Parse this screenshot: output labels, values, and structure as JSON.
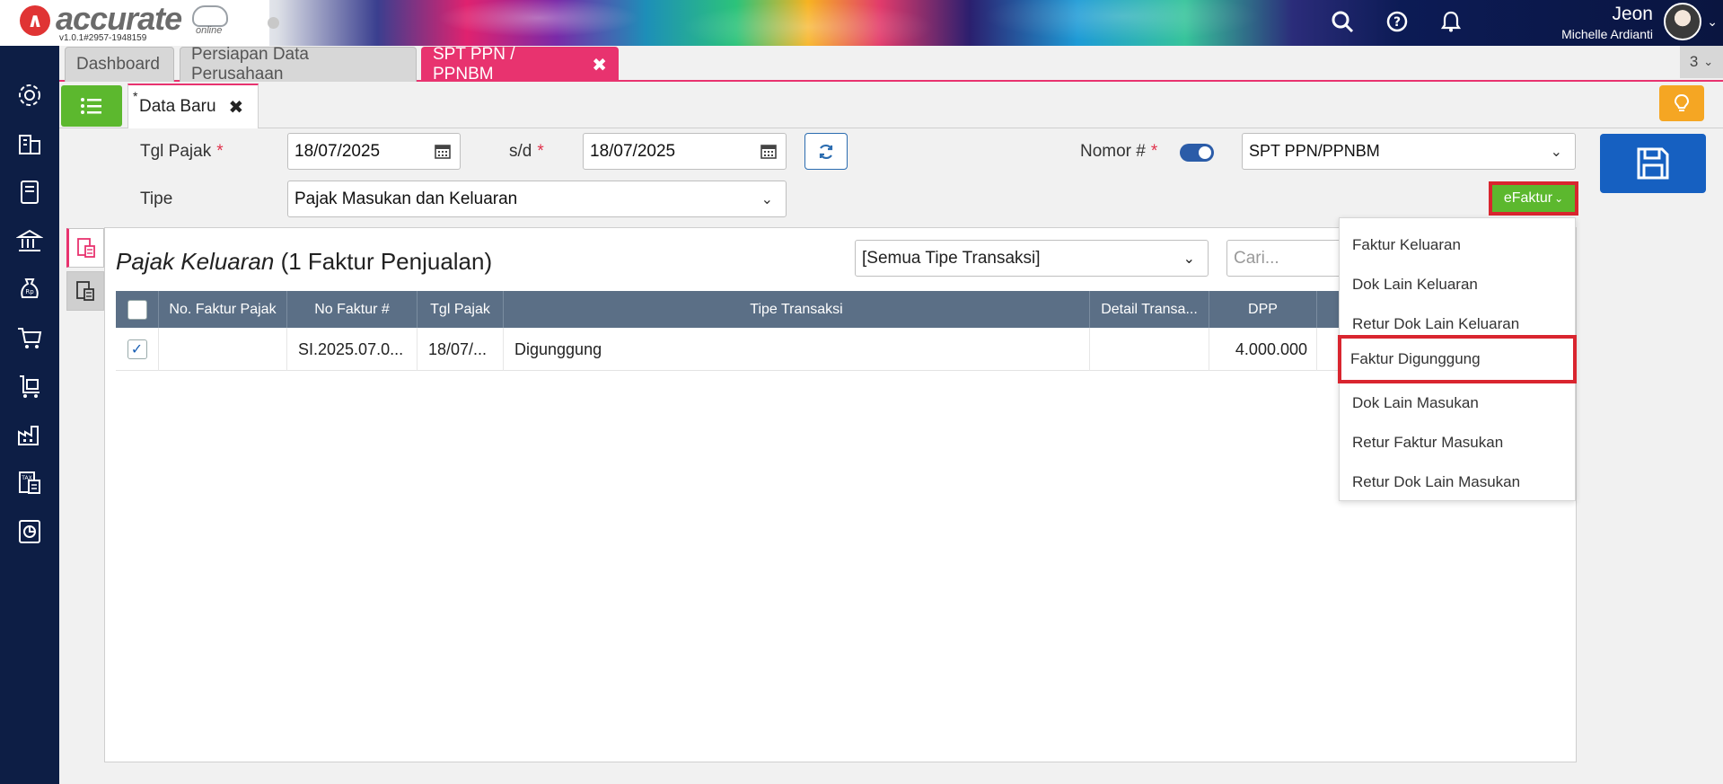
{
  "app": {
    "logo_text": "accurate",
    "logo_sub": "online",
    "version": "v1.0.1#2957-1948159"
  },
  "user": {
    "name": "Jeon",
    "company": "Michelle Ardianti"
  },
  "top_icons": [
    "search-icon",
    "help-icon",
    "bell-icon"
  ],
  "sidebar_icons": [
    "gear-icon",
    "building-icon",
    "book-icon",
    "bank-icon",
    "money-bag-icon",
    "cart-icon",
    "trolley-icon",
    "factory-icon",
    "tax-doc-icon",
    "report-icon"
  ],
  "module_tabs": [
    {
      "label": "Dashboard",
      "active": false
    },
    {
      "label": "Persiapan Data Perusahaan",
      "active": false
    },
    {
      "label": "SPT PPN / PPNBM",
      "active": true,
      "close": "✖"
    }
  ],
  "tab_count": "3",
  "sub_tab": {
    "star": "*",
    "label": "Data Baru",
    "close": "✖"
  },
  "form": {
    "tgl_pajak_label": "Tgl Pajak",
    "tgl_pajak_from": "18/07/2025",
    "sd_label": "s/d",
    "tgl_pajak_to": "18/07/2025",
    "nomor_label": "Nomor #",
    "nomor_value": "SPT PPN/PPNBM",
    "tipe_label": "Tipe",
    "tipe_value": "Pajak Masukan dan Keluaran",
    "required_mark": "*"
  },
  "efaktur_button": "eFaktur",
  "panel": {
    "title_italic": "Pajak Keluaran",
    "title_rest": "(1 Faktur Penjualan)",
    "trx_filter": "[Semua Tipe Transaksi]",
    "search_placeholder": "Cari..."
  },
  "table": {
    "columns": [
      "No. Faktur Pajak",
      "No Faktur #",
      "Tgl Pajak",
      "Tipe Transaksi",
      "Detail Transa...",
      "DPP"
    ],
    "rows": [
      {
        "checked": true,
        "no_faktur_pajak": "",
        "no_faktur": "SI.2025.07.0...",
        "tgl_pajak": "18/07/...",
        "tipe_transaksi": "Digunggung",
        "detail": "",
        "dpp": "4.000.000"
      }
    ]
  },
  "dropdown": {
    "items": [
      {
        "label": "Faktur Keluaran",
        "highlighted": false
      },
      {
        "label": "Dok Lain Keluaran",
        "highlighted": false
      },
      {
        "label": "Retur Dok Lain Keluaran",
        "highlighted": false
      },
      {
        "label": "Faktur Digunggung",
        "highlighted": true
      },
      {
        "label": "Dok Lain Masukan",
        "highlighted": false
      },
      {
        "label": "Retur Faktur Masukan",
        "highlighted": false
      },
      {
        "label": "Retur Dok Lain Masukan",
        "highlighted": false
      }
    ]
  },
  "colors": {
    "accent_pink": "#e8336f",
    "sidebar": "#0d1e45",
    "green": "#5cb82e",
    "save_blue": "#1660c1",
    "grid_header": "#5b6f86",
    "highlight_red": "#d9252f"
  }
}
